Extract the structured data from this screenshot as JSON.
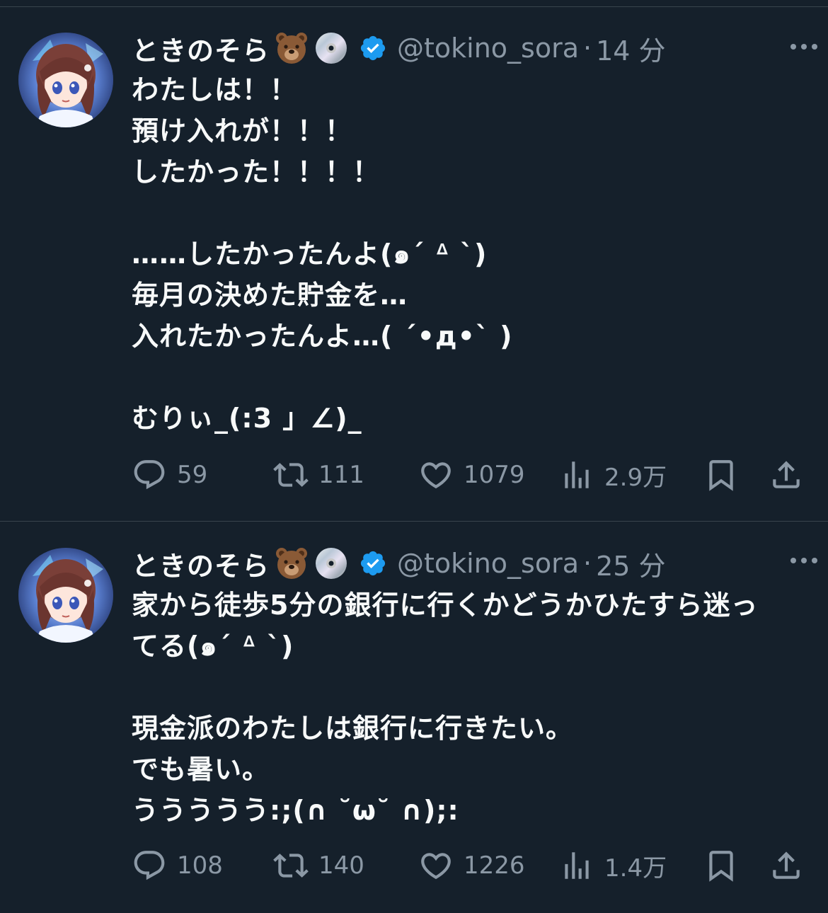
{
  "tweets": [
    {
      "display_name": "ときのそら",
      "handle": "@tokino_sora",
      "separator": "·",
      "time": "14 分",
      "emoji_1": "bear-face-emoji",
      "emoji_2": "dvd-disc-emoji",
      "text": "わたしは！！\n預け入れが！！！\nしたかった！！！！\n\n……したかったんよ(๑ˊ ᐞ ˋ)\n毎月の決めた貯金を…\n入れたかったんよ…( ´•д•` )\n\nむりぃ_(:3 」∠)_",
      "reply_count": "59",
      "retweet_count": "111",
      "like_count": "1079",
      "view_count": "2.9万"
    },
    {
      "display_name": "ときのそら",
      "handle": "@tokino_sora",
      "separator": "·",
      "time": "25 分",
      "emoji_1": "bear-face-emoji",
      "emoji_2": "dvd-disc-emoji",
      "text": "家から徒歩5分の銀行に行くかどうかひたすら迷っ\nてる(๑ˊ ᐞ ˋ)\n\n現金派のわたしは銀行に行きたい。\nでも暑い。\nううううう:;(∩ ˘ω˘ ∩);:",
      "reply_count": "108",
      "retweet_count": "140",
      "like_count": "1226",
      "view_count": "1.4万"
    }
  ],
  "colors": {
    "background": "#15202b",
    "text": "#f7f9f9",
    "secondary": "#8b98a5",
    "verified": "#1d9bf0",
    "divider": "#38444d"
  },
  "icons": [
    "reply-icon",
    "retweet-icon",
    "like-icon",
    "views-icon",
    "bookmark-icon",
    "share-icon",
    "more-icon",
    "verified-badge-icon"
  ]
}
